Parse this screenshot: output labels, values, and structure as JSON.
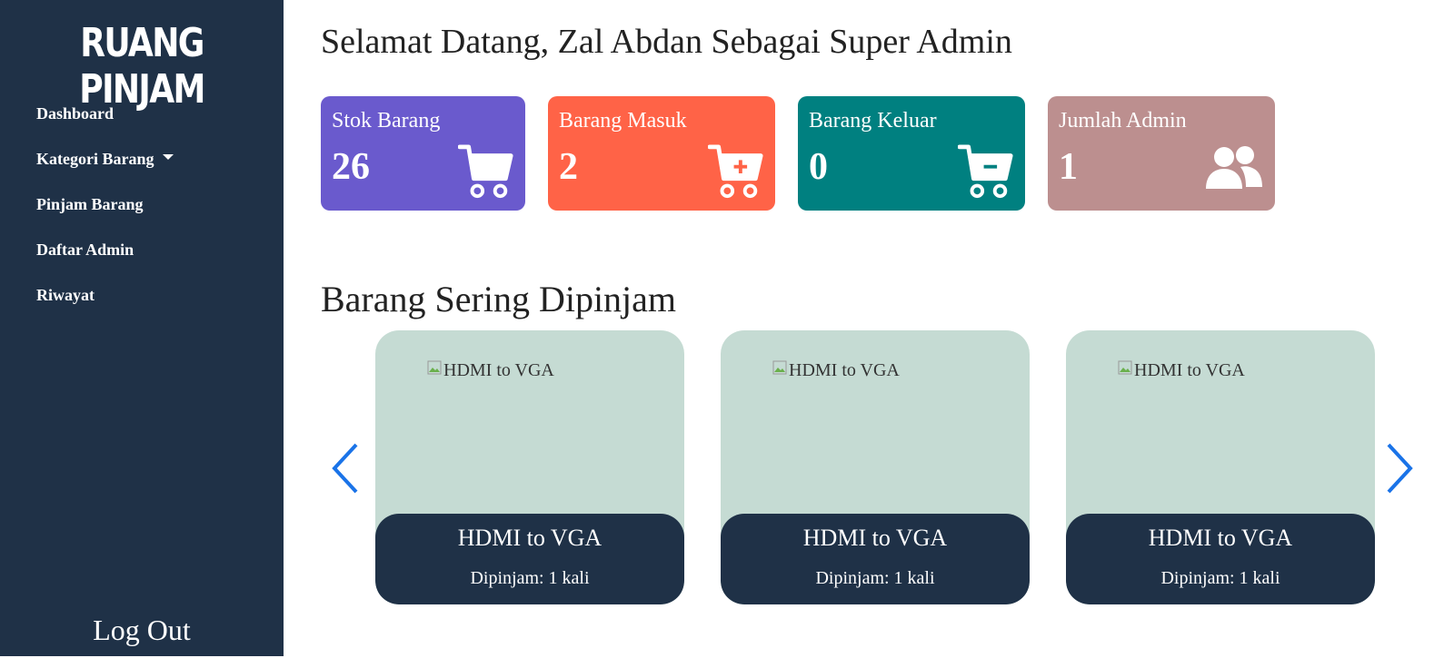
{
  "sidebar": {
    "brand": "RUANG PINJAM",
    "items": [
      {
        "label": "Dashboard"
      },
      {
        "label": "Kategori Barang"
      },
      {
        "label": "Pinjam Barang"
      },
      {
        "label": "Daftar Admin"
      },
      {
        "label": "Riwayat"
      }
    ],
    "logout_label": "Log Out"
  },
  "header": {
    "welcome": "Selamat Datang, Zal Abdan Sebagai Super Admin"
  },
  "stats": [
    {
      "label": "Stok Barang",
      "value": "26",
      "icon": "cart-icon",
      "color": "#6a5acd"
    },
    {
      "label": "Barang Masuk",
      "value": "2",
      "icon": "cart-plus-icon",
      "color": "#ff6347"
    },
    {
      "label": "Barang Keluar",
      "value": "0",
      "icon": "cart-minus-icon",
      "color": "#008080"
    },
    {
      "label": "Jumlah Admin",
      "value": "1",
      "icon": "users-icon",
      "color": "#bc8f8f"
    }
  ],
  "popular": {
    "title": "Barang Sering Dipinjam",
    "items": [
      {
        "image_alt": "HDMI to VGA",
        "name": "HDMI to VGA",
        "count_text": "Dipinjam: 1 kali"
      },
      {
        "image_alt": "HDMI to VGA",
        "name": "HDMI to VGA",
        "count_text": "Dipinjam: 1 kali"
      },
      {
        "image_alt": "HDMI to VGA",
        "name": "HDMI to VGA",
        "count_text": "Dipinjam: 1 kali"
      }
    ]
  }
}
